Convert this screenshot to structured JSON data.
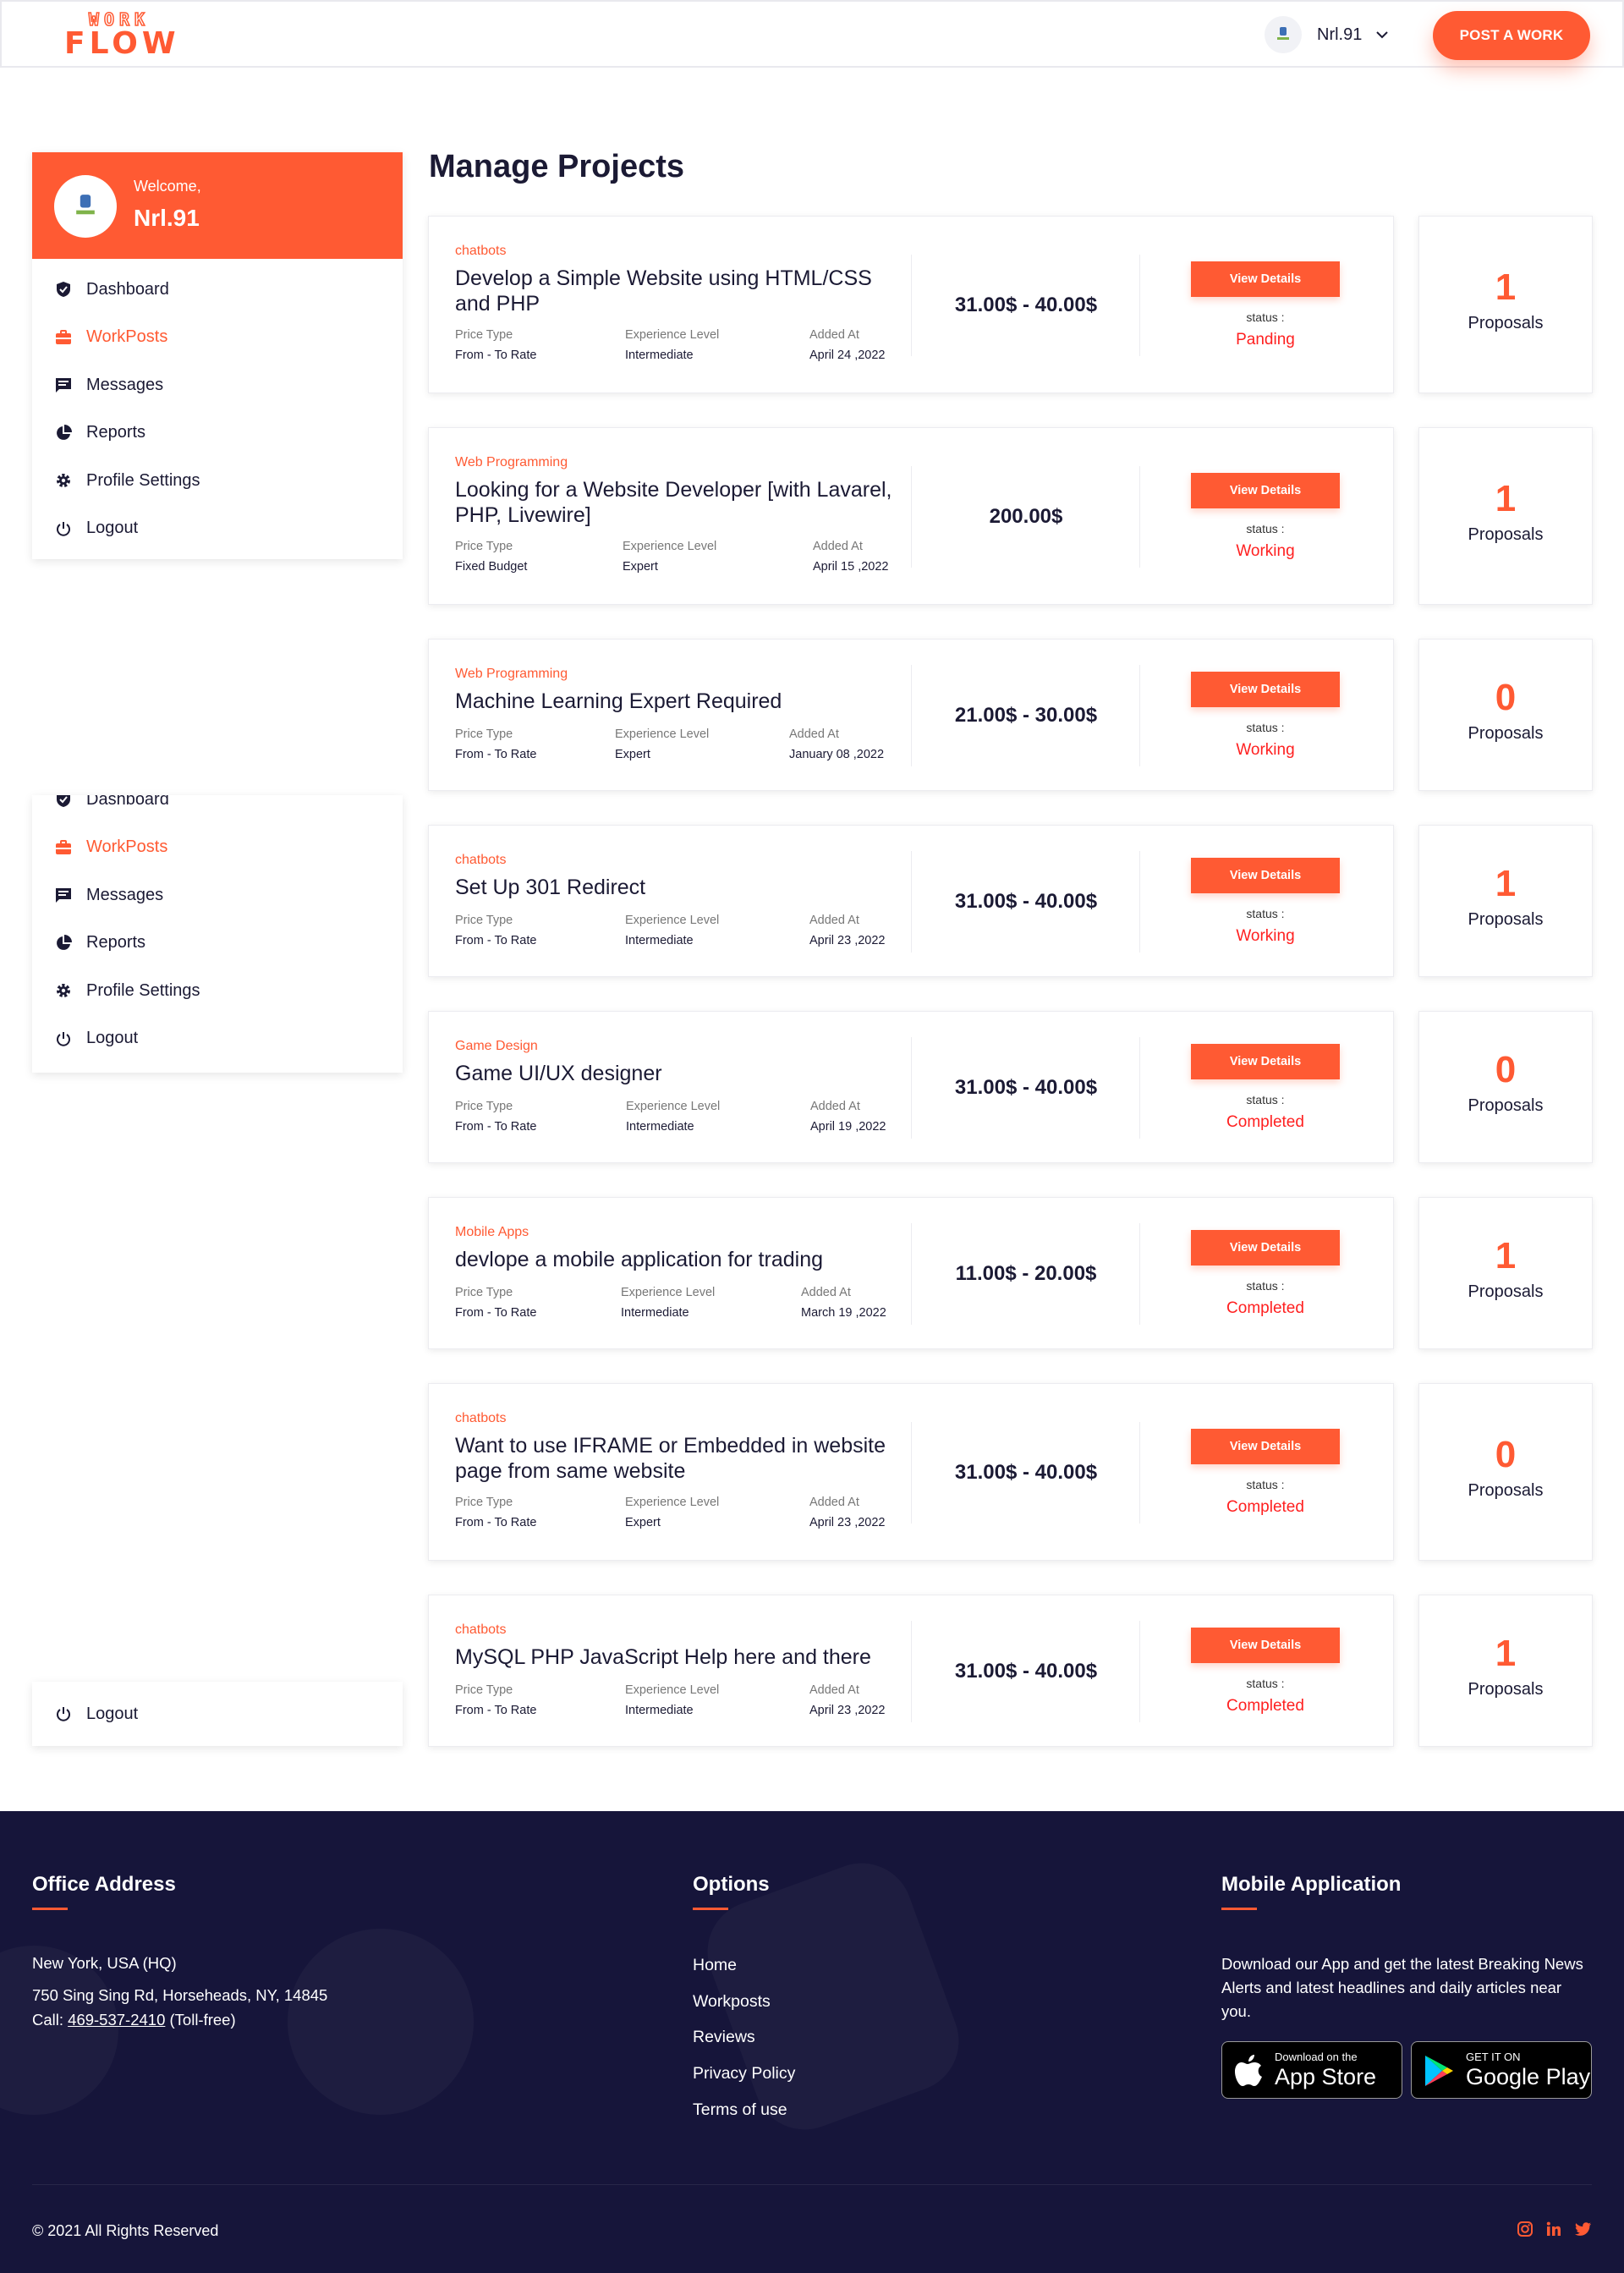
{
  "header": {
    "logo_top": "WORK",
    "logo_bottom": "FLOW",
    "user_name": "Nrl.91",
    "post_button": "POST A WORK"
  },
  "sidebar": {
    "welcome": "Welcome,",
    "name": "Nrl.91",
    "items": [
      {
        "label": "Dashboard",
        "icon": "shield-check-icon"
      },
      {
        "label": "WorkPosts",
        "icon": "briefcase-icon"
      },
      {
        "label": "Messages",
        "icon": "chat-icon"
      },
      {
        "label": "Reports",
        "icon": "pie-chart-icon"
      },
      {
        "label": "Profile Settings",
        "icon": "gear-icon"
      },
      {
        "label": "Logout",
        "icon": "power-icon"
      }
    ]
  },
  "main": {
    "title": "Manage Projects",
    "labels": {
      "price_type": "Price Type",
      "experience": "Experience Level",
      "added": "Added At",
      "view": "View Details",
      "status": "status :",
      "proposals": "Proposals"
    },
    "projects": [
      {
        "category": "chatbots",
        "title": "Develop a Simple Website using HTML/CSS and PHP",
        "price_type": "From - To Rate",
        "experience": "Intermediate",
        "added": "April 24 ,2022",
        "price": "31.00$ - 40.00$",
        "status": "Panding",
        "proposals": "1"
      },
      {
        "category": "Web Programming",
        "title": "Looking for a Website Developer [with Lavarel, PHP, Livewire]",
        "price_type": "Fixed Budget",
        "experience": "Expert",
        "added": "April 15 ,2022",
        "price": "200.00$",
        "status": "Working",
        "proposals": "1"
      },
      {
        "category": "Web Programming",
        "title": "Machine Learning Expert Required",
        "price_type": "From - To Rate",
        "experience": "Expert",
        "added": "January 08 ,2022",
        "price": "21.00$ - 30.00$",
        "status": "Working",
        "proposals": "0"
      },
      {
        "category": "chatbots",
        "title": "Set Up 301 Redirect",
        "price_type": "From - To Rate",
        "experience": "Intermediate",
        "added": "April 23 ,2022",
        "price": "31.00$ - 40.00$",
        "status": "Working",
        "proposals": "1"
      },
      {
        "category": "Game Design",
        "title": "Game UI/UX designer",
        "price_type": "From - To Rate",
        "experience": "Intermediate",
        "added": "April 19 ,2022",
        "price": "31.00$ - 40.00$",
        "status": "Completed",
        "proposals": "0"
      },
      {
        "category": "Mobile Apps",
        "title": "devlope a mobile application for trading",
        "price_type": "From - To Rate",
        "experience": "Intermediate",
        "added": "March 19 ,2022",
        "price": "11.00$ - 20.00$",
        "status": "Completed",
        "proposals": "1"
      },
      {
        "category": "chatbots",
        "title": "Want to use IFRAME or Embedded in website page from same website",
        "price_type": "From - To Rate",
        "experience": "Expert",
        "added": "April 23 ,2022",
        "price": "31.00$ - 40.00$",
        "status": "Completed",
        "proposals": "0"
      },
      {
        "category": "chatbots",
        "title": "MySQL PHP JavaScript Help here and there",
        "price_type": "From - To Rate",
        "experience": "Intermediate",
        "added": "April 23 ,2022",
        "price": "31.00$ - 40.00$",
        "status": "Completed",
        "proposals": "1"
      }
    ]
  },
  "footer": {
    "office": {
      "heading": "Office Address",
      "line1": "New York, USA (HQ)",
      "line2": "750 Sing Sing Rd, Horseheads, NY, 14845",
      "call_prefix": "Call: ",
      "phone": "469-537-2410",
      "call_suffix": " (Toll-free)"
    },
    "options": {
      "heading": "Options",
      "links": [
        "Home",
        "Workposts",
        "Reviews",
        "Privacy Policy",
        "Terms of use"
      ]
    },
    "mobile": {
      "heading": "Mobile Application",
      "text": "Download our App and get the latest Breaking News Alerts and latest headlines and daily articles near you.",
      "appstore_small": "Download on the",
      "appstore_big": "App Store",
      "googleplay_small": "GET IT ON",
      "googleplay_big": "Google Play"
    },
    "copyright": "© 2021 All Rights Reserved"
  },
  "colors": {
    "accent": "#ff5a33",
    "footer_bg": "#16153a",
    "status": "#ff2020",
    "text": "#1b1a34"
  }
}
